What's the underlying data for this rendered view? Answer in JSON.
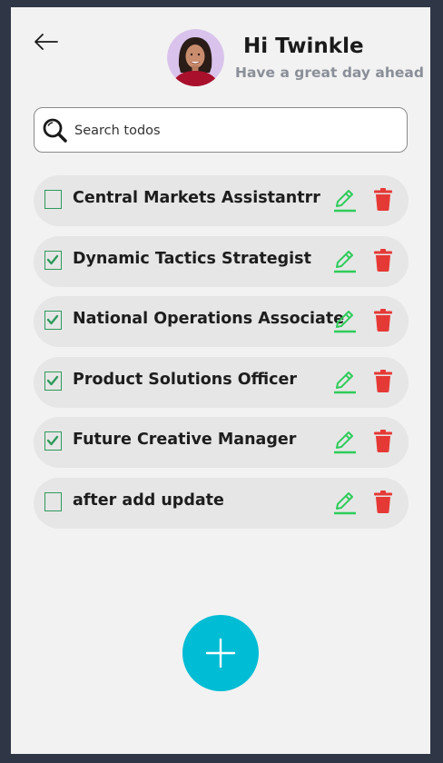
{
  "header": {
    "back_icon": "arrow-left-icon",
    "greeting": "Hi Twinkle",
    "subgreeting": "Have a great day ahead"
  },
  "search": {
    "placeholder": "Search todos",
    "icon": "search-icon"
  },
  "todos": [
    {
      "text": "Central Markets Assistantrr",
      "done": false
    },
    {
      "text": "Dynamic Tactics Strategist",
      "done": true
    },
    {
      "text": "National Operations Associate",
      "done": true
    },
    {
      "text": "Product Solutions Officer",
      "done": true
    },
    {
      "text": "Future Creative Manager",
      "done": true
    },
    {
      "text": "after add update",
      "done": false
    }
  ],
  "colors": {
    "background": "#f2f2f2",
    "frame": "#2f3747",
    "item_background": "#e6e6e6",
    "checkbox": "#2e9a5a",
    "edit": "#2ecc5a",
    "delete": "#e53935",
    "fab": "#00bcd4"
  },
  "fab": {
    "icon": "plus-icon"
  }
}
